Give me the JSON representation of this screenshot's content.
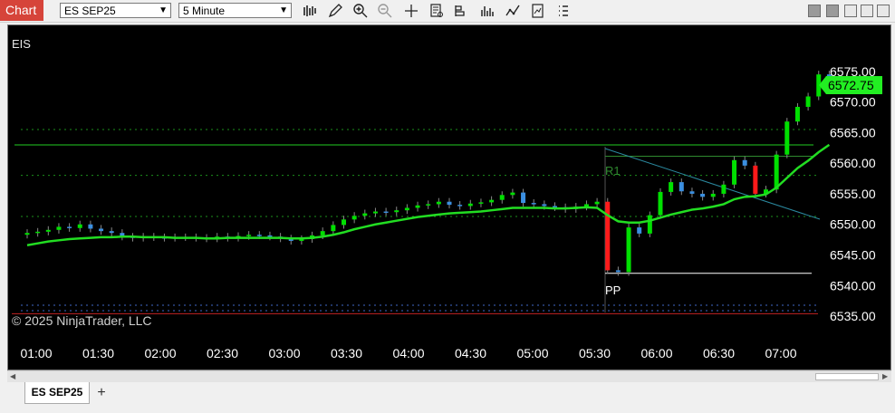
{
  "toolbar": {
    "chart_label": "Chart",
    "instrument": "ES SEP25",
    "interval": "5 Minute",
    "icons": [
      "bars-type-icon",
      "draw-pencil-icon",
      "zoom-in-icon",
      "zoom-out-icon",
      "crosshair-icon",
      "data-box-icon",
      "properties-icon",
      "indicators-icon",
      "strategies-icon",
      "templates-icon",
      "menu-icon"
    ]
  },
  "chart": {
    "symbol_label": "EIS",
    "copyright": "© 2025 NinjaTrader, LLC",
    "last_price": "6572.75",
    "price_labels": [
      "6575.00",
      "6570.00",
      "6565.00",
      "6560.00",
      "6555.00",
      "6550.00",
      "6545.00",
      "6540.00",
      "6535.00"
    ],
    "time_labels": [
      "01:00",
      "01:30",
      "02:00",
      "02:30",
      "03:00",
      "03:30",
      "04:00",
      "04:30",
      "05:00",
      "05:30",
      "06:00",
      "06:30",
      "07:00"
    ],
    "pivot_labels": {
      "r1": "R1",
      "pp": "PP"
    },
    "colors": {
      "background": "#000000",
      "up": "#00e000",
      "down": "#ff1a1a",
      "neutral": "#3b8fe0",
      "ma": "#22dd22",
      "accent": "#d6443a"
    }
  },
  "chart_data": {
    "type": "candlestick",
    "ylim": [
      6532.5,
      6580
    ],
    "y_ticks": [
      6575,
      6570,
      6565,
      6560,
      6555,
      6550,
      6545,
      6540,
      6535
    ],
    "x_ticks": [
      "01:00",
      "01:30",
      "02:00",
      "02:30",
      "03:00",
      "03:30",
      "04:00",
      "04:30",
      "05:00",
      "05:30",
      "06:00",
      "06:30",
      "07:00"
    ],
    "last_price": 6572.75,
    "levels": [
      {
        "name": "R1",
        "value": 6561.2
      },
      {
        "name": "PP",
        "value": 6542.0
      }
    ],
    "candles_close": [
      6548.6,
      6548.8,
      6549.1,
      6549.6,
      6549.4,
      6550.0,
      6549.3,
      6548.9,
      6548.6,
      6548.0,
      6547.8,
      6548.0,
      6547.9,
      6547.8,
      6547.9,
      6547.9,
      6547.8,
      6547.7,
      6548.0,
      6547.8,
      6548.1,
      6548.3,
      6548.2,
      6548.0,
      6547.7,
      6547.3,
      6547.6,
      6548.2,
      6548.9,
      6549.9,
      6550.8,
      6551.4,
      6551.8,
      6552.1,
      6552.0,
      6552.3,
      6552.7,
      6553.1,
      6553.3,
      6553.7,
      6553.2,
      6553.0,
      6553.4,
      6553.6,
      6554.0,
      6554.8,
      6555.2,
      6553.5,
      6553.3,
      6553.0,
      6552.8,
      6552.5,
      6552.9,
      6553.3,
      6553.7,
      6542.5,
      6542.2,
      6549.5,
      6548.5,
      6551.5,
      6555.3,
      6556.9,
      6555.4,
      6555.0,
      6554.5,
      6555.0,
      6556.5,
      6560.5,
      6559.6,
      6555.0,
      6555.7,
      6561.4,
      6566.8,
      6569.2,
      6570.9,
      6574.5,
      6572.7
    ],
    "moving_average": [
      6546.6,
      6546.9,
      6547.2,
      6547.4,
      6547.6,
      6547.7,
      6547.8,
      6547.9,
      6547.9,
      6548.0,
      6548.0,
      6547.9,
      6547.9,
      6547.9,
      6547.8,
      6547.8,
      6547.8,
      6547.7,
      6547.7,
      6547.8,
      6547.8,
      6547.8,
      6547.8,
      6547.8,
      6547.8,
      6547.7,
      6547.7,
      6547.8,
      6548.0,
      6548.3,
      6548.7,
      6549.2,
      6549.6,
      6550.0,
      6550.3,
      6550.6,
      6550.9,
      6551.2,
      6551.4,
      6551.6,
      6551.8,
      6551.9,
      6552.0,
      6552.1,
      6552.3,
      6552.5,
      6552.7,
      6552.7,
      6552.7,
      6552.7,
      6552.6,
      6552.6,
      6552.7,
      6552.8,
      6552.7,
      6551.5,
      6550.5,
      6550.3,
      6550.3,
      6550.6,
      6551.1,
      6551.6,
      6552.0,
      6552.4,
      6552.6,
      6552.9,
      6553.3,
      6554.1,
      6554.5,
      6554.6,
      6554.9,
      6556.0,
      6557.6,
      6559.2,
      6560.4,
      6561.8,
      6563.0
    ]
  }
}
